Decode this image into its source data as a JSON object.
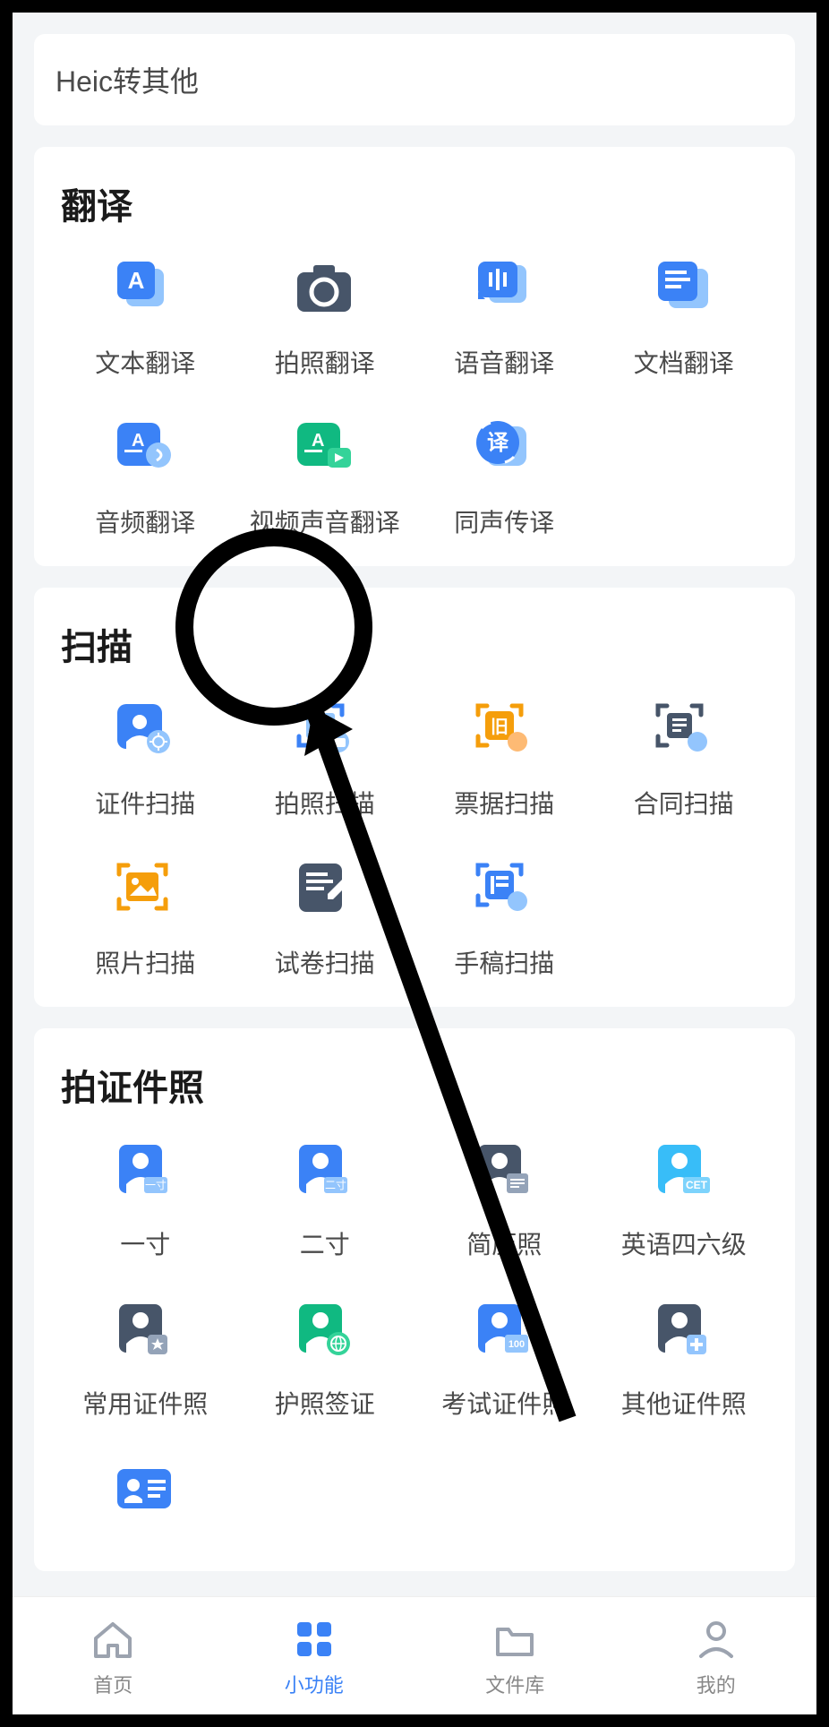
{
  "topItem": {
    "label": "Heic转其他"
  },
  "sections": [
    {
      "title": "翻译",
      "items": [
        {
          "label": "文本翻译",
          "icon": "text-a"
        },
        {
          "label": "拍照翻译",
          "icon": "camera"
        },
        {
          "label": "语音翻译",
          "icon": "voice"
        },
        {
          "label": "文档翻译",
          "icon": "doc-lines"
        },
        {
          "label": "音频翻译",
          "icon": "audio"
        },
        {
          "label": "视频声音翻译",
          "icon": "video"
        },
        {
          "label": "同声传译",
          "icon": "interpret"
        }
      ]
    },
    {
      "title": "扫描",
      "items": [
        {
          "label": "证件扫描",
          "icon": "id-gear"
        },
        {
          "label": "拍照扫描",
          "icon": "photo-scan"
        },
        {
          "label": "票据扫描",
          "icon": "receipt"
        },
        {
          "label": "合同扫描",
          "icon": "contract"
        },
        {
          "label": "照片扫描",
          "icon": "photo"
        },
        {
          "label": "试卷扫描",
          "icon": "exam"
        },
        {
          "label": "手稿扫描",
          "icon": "manuscript"
        }
      ]
    },
    {
      "title": "拍证件照",
      "items": [
        {
          "label": "一寸",
          "icon": "id-1"
        },
        {
          "label": "二寸",
          "icon": "id-2"
        },
        {
          "label": "简历照",
          "icon": "resume"
        },
        {
          "label": "英语四六级",
          "icon": "cet"
        },
        {
          "label": "常用证件照",
          "icon": "id-star"
        },
        {
          "label": "护照签证",
          "icon": "passport"
        },
        {
          "label": "考试证件照",
          "icon": "id-exam"
        },
        {
          "label": "其他证件照",
          "icon": "id-plus"
        },
        {
          "label": "",
          "icon": "id-card"
        }
      ]
    }
  ],
  "tabbar": [
    {
      "label": "首页",
      "icon": "home",
      "active": false
    },
    {
      "label": "小功能",
      "icon": "grid",
      "active": true
    },
    {
      "label": "文件库",
      "icon": "folder",
      "active": false
    },
    {
      "label": "我的",
      "icon": "person",
      "active": false
    }
  ]
}
